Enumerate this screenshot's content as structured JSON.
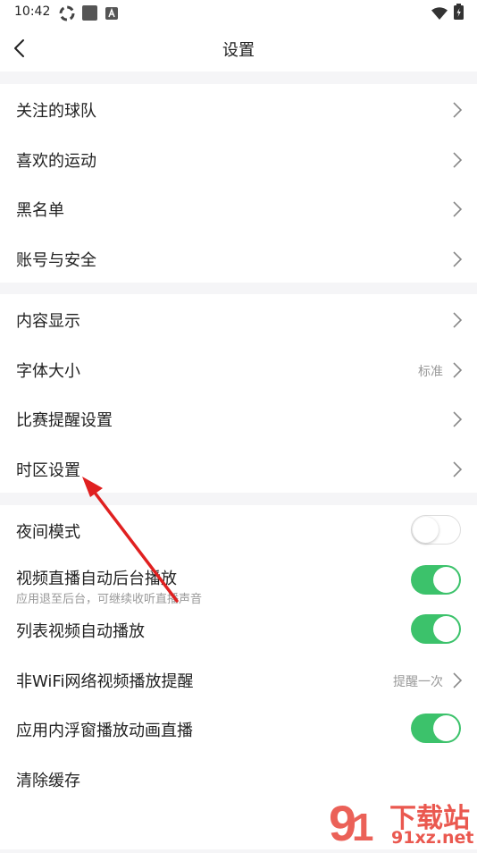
{
  "status_bar": {
    "time": "10:42",
    "icons": [
      "sync-icon",
      "app-square-icon",
      "notification-a-icon",
      "wifi-icon",
      "battery-charging-icon"
    ]
  },
  "nav": {
    "title": "设置",
    "back_icon": "chevron-left-icon"
  },
  "group1": [
    {
      "label": "关注的球队"
    },
    {
      "label": "喜欢的运动"
    },
    {
      "label": "黑名单"
    },
    {
      "label": "账号与安全"
    }
  ],
  "group2": [
    {
      "label": "内容显示"
    },
    {
      "label": "字体大小",
      "value": "标准"
    },
    {
      "label": "比赛提醒设置"
    },
    {
      "label": "时区设置"
    }
  ],
  "group3": [
    {
      "label": "夜间模式",
      "toggle": false
    },
    {
      "label": "视频直播自动后台播放",
      "sublabel": "应用退至后台，可继续收听直播声音",
      "toggle": true
    },
    {
      "label": "列表视频自动播放",
      "toggle": true
    },
    {
      "label": "非WiFi网络视频播放提醒",
      "value": "提醒一次"
    },
    {
      "label": "应用内浮窗播放动画直播",
      "toggle": true
    },
    {
      "label": "清除缓存"
    }
  ],
  "colors": {
    "toggle_on": "#3cc26b",
    "arrow": "#e02020",
    "section_gap": "#f5f5f7"
  },
  "watermark": {
    "text1": "下载站",
    "text2": "91xz.net"
  }
}
